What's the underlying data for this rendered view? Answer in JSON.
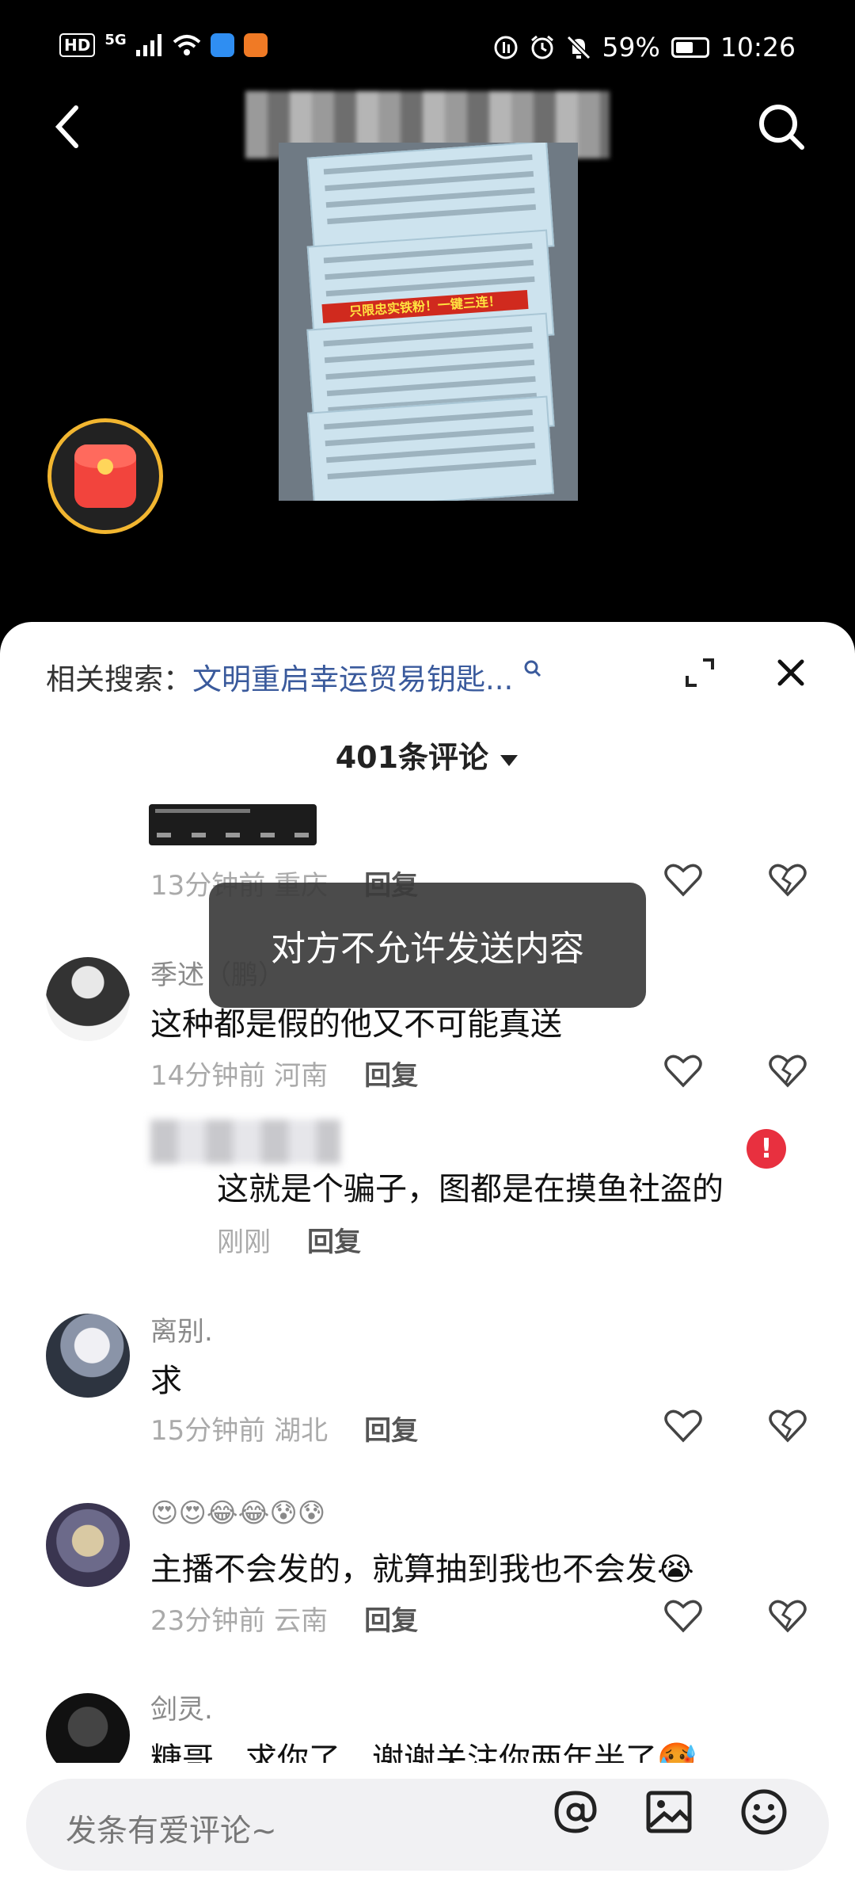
{
  "status_bar": {
    "hd": "HD",
    "network": "5G",
    "battery": "59%",
    "battery_level": 0.59,
    "time": "10:26"
  },
  "video": {
    "overlay_text": "只限忠实铁粉！一键三连！",
    "icons": {
      "back": "back-arrow-icon",
      "search": "search-icon",
      "red_packet": "red-packet-icon"
    }
  },
  "sheet": {
    "related_prefix": "相关搜索：",
    "related_query": "文明重启幸运贸易钥匙...",
    "comment_count": "401条评论"
  },
  "toast": "对方不允许发送内容",
  "comments": [
    {
      "time": "13分钟前",
      "location": "重庆",
      "reply": "回复"
    },
    {
      "name": "季述（鹏）",
      "text": "这种都是假的他又不可能真送",
      "time": "14分钟前",
      "location": "河南",
      "reply": "回复"
    },
    {
      "text": "这就是个骗子，图都是在摸鱼社盗的",
      "time": "刚刚",
      "reply": "回复"
    },
    {
      "name": "离别.",
      "text": "求",
      "time": "15分钟前",
      "location": "湖北",
      "reply": "回复"
    },
    {
      "emoji_line": "😍😍😂😂😰😰",
      "text": "主播不会发的，就算抽到我也不会发😭",
      "time": "23分钟前",
      "location": "云南",
      "reply": "回复"
    },
    {
      "name": "剑灵.",
      "text": "糖哥，求你了，谢谢关注你两年半了🥵"
    }
  ],
  "input": {
    "placeholder": "发条有爱评论~"
  },
  "colors": {
    "sheet_bg": "#ffffff",
    "link_blue": "#3a5a9c",
    "toast_bg": "#3c3c3c",
    "error_red": "#e8303f",
    "redpacket_ring": "#f2b630"
  }
}
